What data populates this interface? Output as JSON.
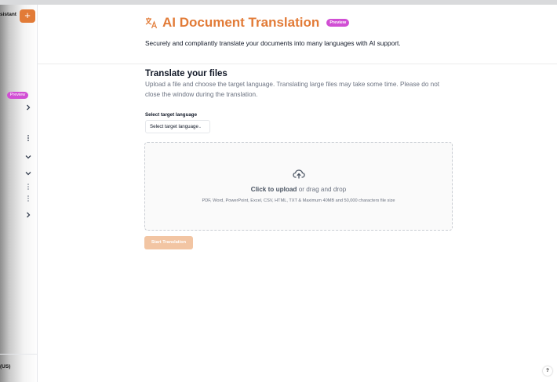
{
  "sidebar": {
    "top_label": "sistant",
    "add_label": "+",
    "preview_badge": "Preview",
    "locale_label": "(US)",
    "icons": [
      "chevron-right-icon",
      "kebab-icon",
      "chevron-down-icon",
      "chevron-down-icon",
      "kebab-icon",
      "kebab-icon",
      "chevron-right-icon"
    ]
  },
  "header": {
    "title": "AI Document Translation",
    "badge": "Preview",
    "subtitle": "Securely and compliantly translate your documents into many languages with AI support."
  },
  "main": {
    "section_title": "Translate your files",
    "section_desc": "Upload a file and choose the target language. Translating large files may take some time. Please do not close the window during the translation.",
    "field_label": "Select target language",
    "select_value": "Select target language",
    "upload_link": "Click to upload",
    "upload_rest": " or drag and drop",
    "upload_hint": "PDF, Word, PowerPoint, Excel, CSV, HTML, TXT & Maximum 40MB and 50,000 characters file size",
    "start_label": "Start Translation"
  },
  "help_label": "?",
  "colors": {
    "accent": "#e27b37",
    "badge": "#d14fd4",
    "disabled_button": "#f2c5a3"
  }
}
